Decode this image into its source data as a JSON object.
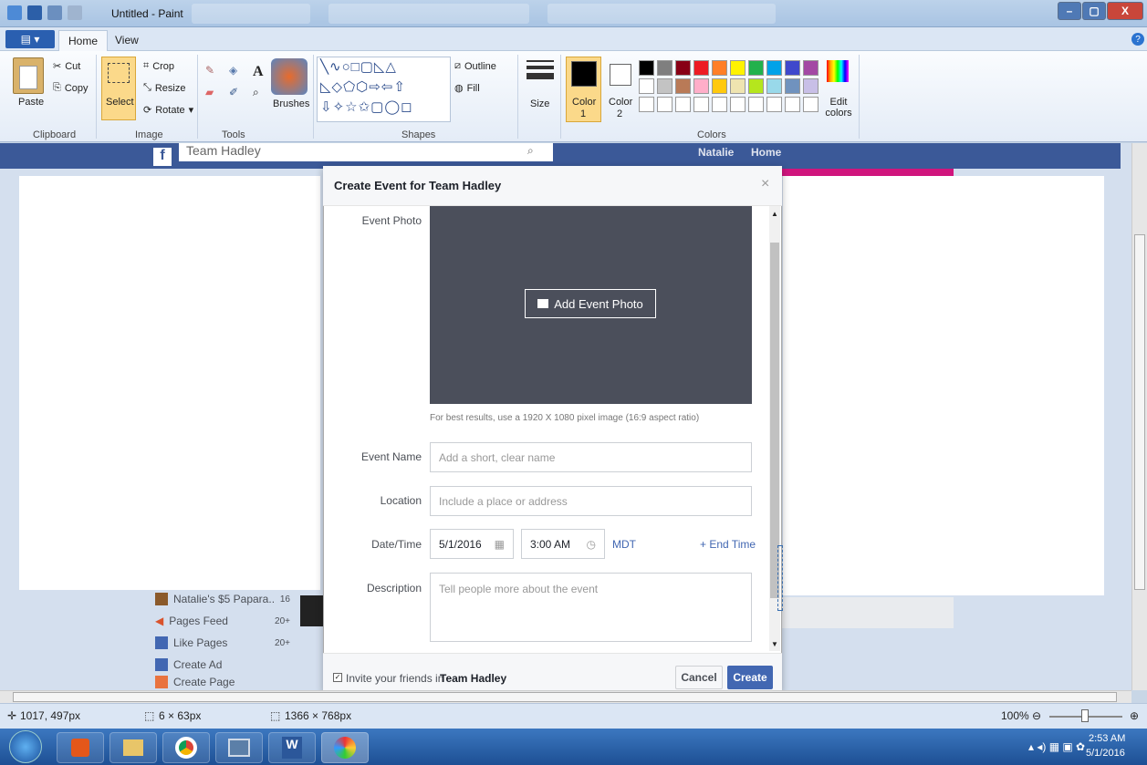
{
  "window": {
    "title": "Untitled - Paint",
    "minimize": "–",
    "maximize": "▢",
    "close": "X"
  },
  "ribbon": {
    "file_menu": "▤ ▾",
    "tabs": [
      "Home",
      "View"
    ],
    "help": "?",
    "clipboard": {
      "paste": "Paste",
      "cut": "Cut",
      "copy": "Copy",
      "group": "Clipboard"
    },
    "image": {
      "select": "Select",
      "crop": "Crop",
      "resize": "Resize",
      "rotate": "Rotate",
      "group": "Image"
    },
    "tools": {
      "group": "Tools"
    },
    "brushes": "Brushes",
    "shapes": {
      "outline": "Outline",
      "fill": "Fill",
      "group": "Shapes"
    },
    "size": "Size",
    "colors": {
      "color1": "Color",
      "color1_num": "1",
      "color2": "Color",
      "color2_num": "2",
      "edit": "Edit colors",
      "group": "Colors",
      "row1": [
        "#000000",
        "#7f7f7f",
        "#880015",
        "#ed1c24",
        "#ff7f27",
        "#fff200",
        "#22b14c",
        "#00a2e8",
        "#3f48cc",
        "#a349a4"
      ],
      "row2": [
        "#ffffff",
        "#c3c3c3",
        "#b97a57",
        "#ffaec9",
        "#ffc90e",
        "#efe4b0",
        "#b5e61d",
        "#99d9ea",
        "#7092be",
        "#c8bfe7"
      ]
    }
  },
  "background": {
    "search_text": "Team Hadley",
    "user": "Natalie",
    "home": "Home",
    "sidebar": [
      {
        "label": "Natalie's $5 Papara...",
        "count": "16"
      },
      {
        "label": "Pages Feed",
        "count": "20+"
      },
      {
        "label": "Like Pages",
        "count": "20+"
      },
      {
        "label": "Create Ad",
        "count": ""
      },
      {
        "label": "Create Page",
        "count": ""
      }
    ]
  },
  "modal": {
    "title": "Create Event for Team Hadley",
    "close": "×",
    "photo_label": "Event Photo",
    "add_photo": "Add Event Photo",
    "photo_hint": "For best results, use a 1920 X 1080 pixel image (16:9 aspect ratio)",
    "name_label": "Event Name",
    "name_placeholder": "Add a short, clear name",
    "location_label": "Location",
    "location_placeholder": "Include a place or address",
    "datetime_label": "Date/Time",
    "date_value": "5/1/2016",
    "time_value": "3:00 AM",
    "timezone": "MDT",
    "end_time": "+ End Time",
    "description_label": "Description",
    "description_placeholder": "Tell people more about the event",
    "invite_prefix": "Invite your friends in",
    "invite_group": "Team Hadley",
    "cancel": "Cancel",
    "create": "Create"
  },
  "status": {
    "cursor": "1017, 497px",
    "selection": "6 × 63px",
    "image_size": "1366 × 768px",
    "zoom": "100%"
  },
  "taskbar": {
    "time": "2:53 AM",
    "date": "5/1/2016"
  }
}
